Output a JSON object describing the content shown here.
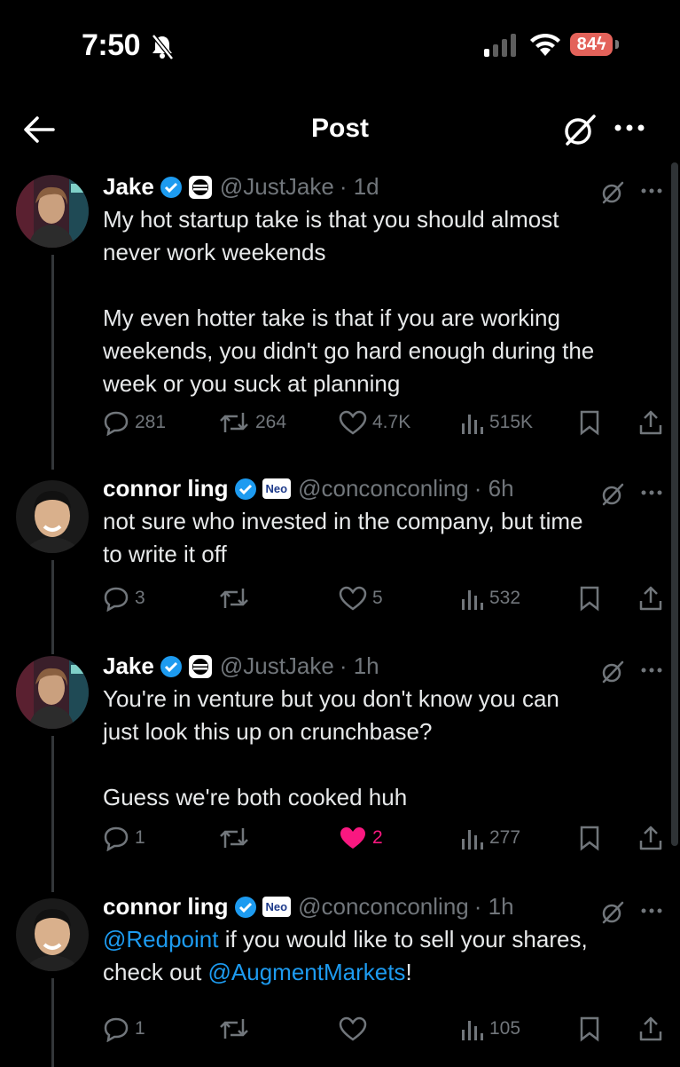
{
  "status": {
    "time": "7:50",
    "battery": "84"
  },
  "nav": {
    "title": "Post"
  },
  "posts": [
    {
      "name": "Jake",
      "handle": "@JustJake",
      "age": "· 1d",
      "text": "My hot startup take is that you should almost\nnever work weekends\n\nMy even hotter take is that if you are working\nweekends, you didn't go hard enough during the\nweek or you suck at planning",
      "replies": "281",
      "reposts": "264",
      "likes": "4.7K",
      "views": "515K"
    },
    {
      "name": "connor ling",
      "handle": "@conconconling",
      "age": "· 6h",
      "affiliate": "Neo",
      "text": "not sure who invested in the company, but time\nto write it off",
      "replies": "3",
      "reposts": "",
      "likes": "5",
      "views": "532"
    },
    {
      "name": "Jake",
      "handle": "@JustJake",
      "age": "· 1h",
      "text": "You're in venture but you don't know you can\njust look this up on crunchbase?\n\nGuess we're both cooked huh",
      "replies": "1",
      "reposts": "",
      "likes": "2",
      "views": "277"
    },
    {
      "name": "connor ling",
      "handle": "@conconconling",
      "age": "· 1h",
      "affiliate": "Neo",
      "text_mention1": "@Redpoint",
      "text_mid": " if you would like to sell your shares,\ncheck out ",
      "text_mention2": "@AugmentMarkets",
      "text_end": "!",
      "replies": "1",
      "reposts": "",
      "likes": "",
      "views": "105"
    }
  ],
  "colors": {
    "accent": "#1d9bf0",
    "like": "#f91880",
    "muted": "#71767b"
  }
}
